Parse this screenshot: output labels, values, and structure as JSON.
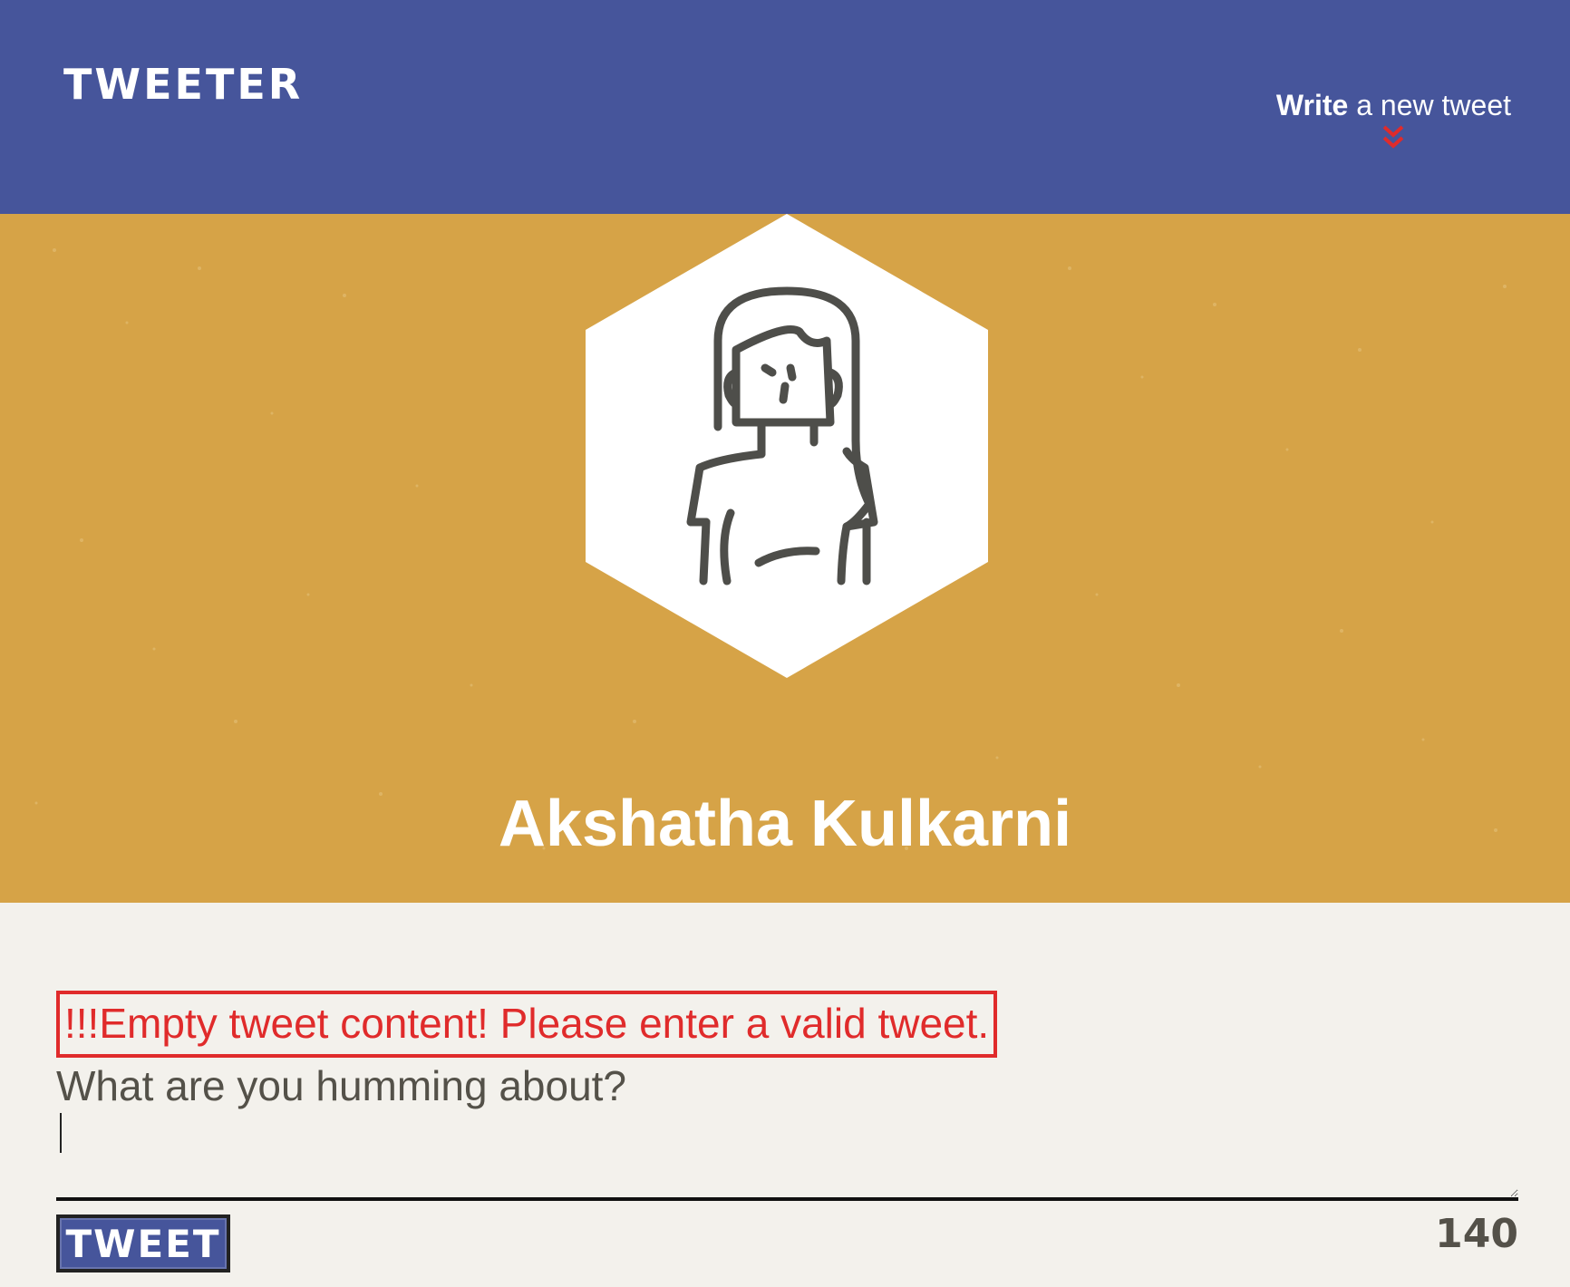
{
  "nav": {
    "brand": "TWEETER",
    "write_bold": "Write",
    "write_rest": " a new tweet",
    "chevron_icon": "double-chevron-down-icon",
    "chevron_color": "#e02b2b"
  },
  "profile": {
    "avatar_icon": "woman-avatar-icon",
    "name": "Akshatha Kulkarni"
  },
  "composer": {
    "error": "!!!Empty tweet content! Please enter a valid tweet.",
    "label": "What are you humming about?",
    "value": "",
    "tweet_button": "TWEET",
    "char_count": "140"
  },
  "colors": {
    "nav_bg": "#46559b",
    "profile_bg": "#d6a347",
    "page_bg": "#f3f1ec",
    "error": "#e02b2b"
  }
}
